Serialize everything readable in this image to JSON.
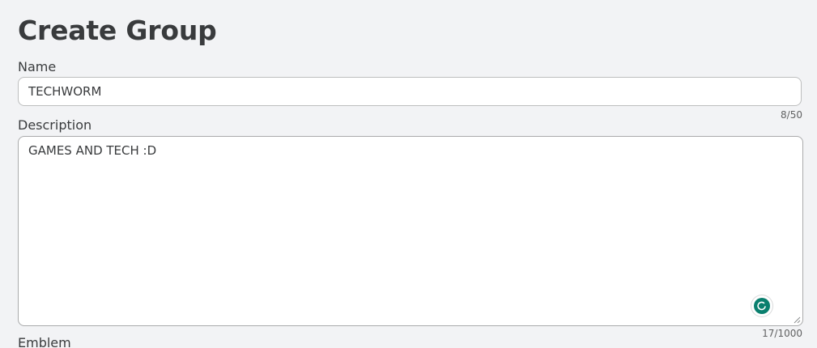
{
  "page": {
    "title": "Create Group"
  },
  "form": {
    "name_label": "Name",
    "name_value": "TECHWORM",
    "name_counter": "8/50",
    "description_label": "Description",
    "description_value": "GAMES AND TECH :D",
    "description_counter": "17/1000",
    "emblem_label": "Emblem"
  },
  "icons": {
    "grammar_assistant": "grammarly-icon",
    "resize": "resize-handle-icon"
  },
  "colors": {
    "background": "#f2f3f5",
    "text": "#393b3d",
    "accent": "#0a7f6e"
  }
}
